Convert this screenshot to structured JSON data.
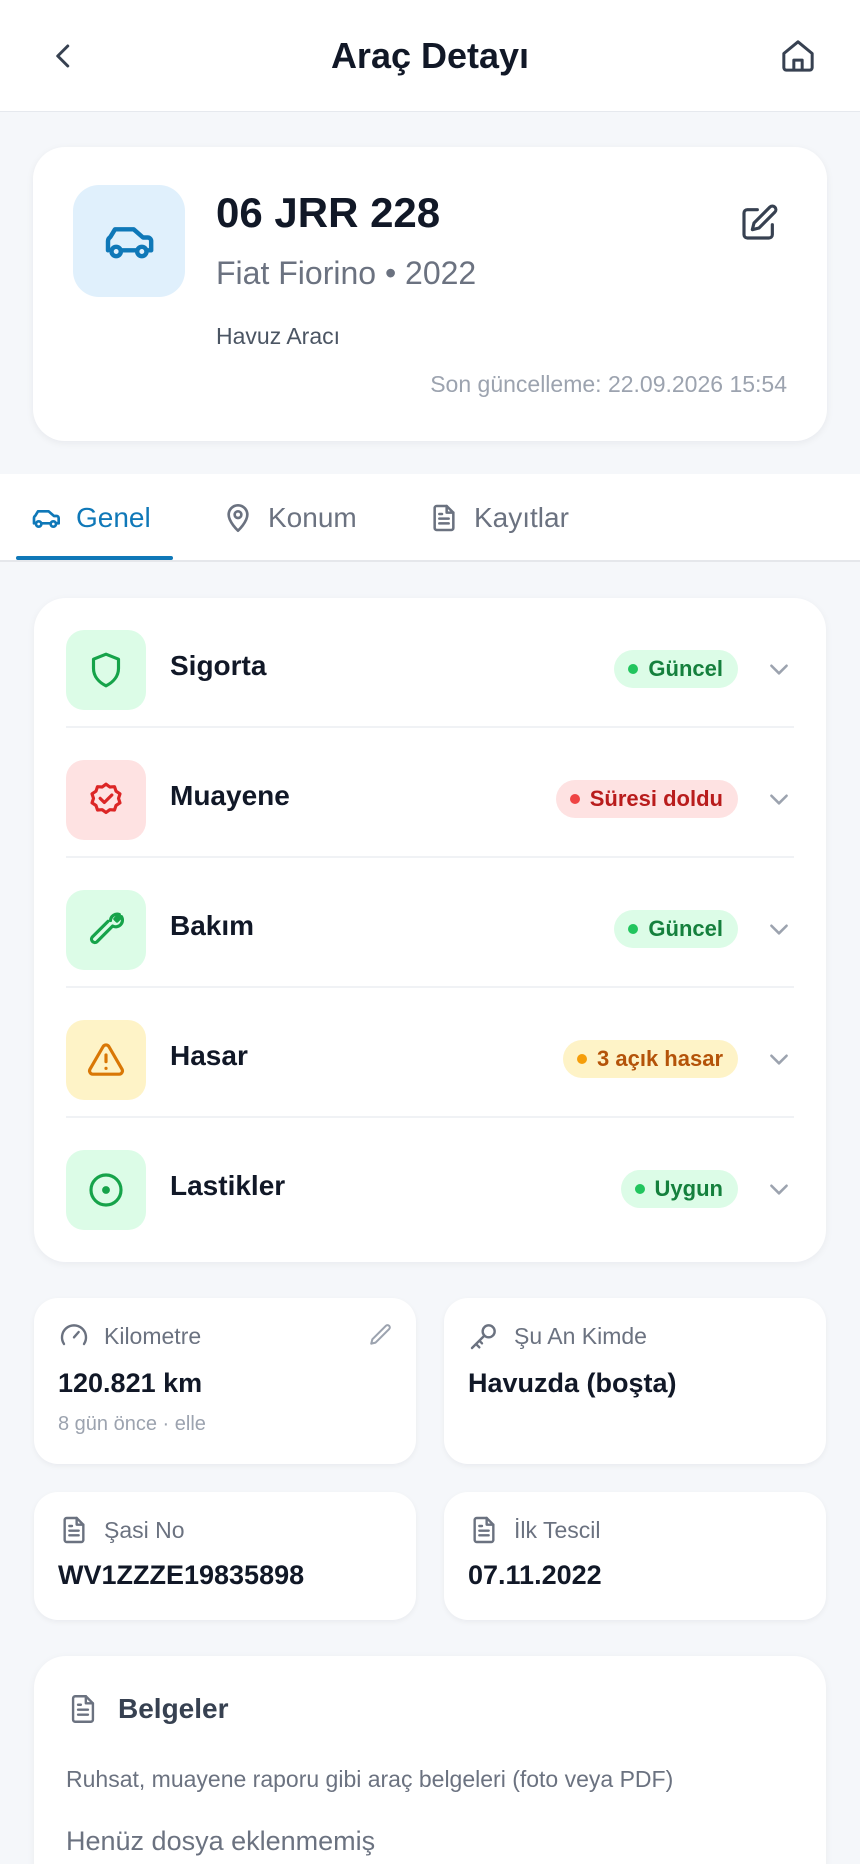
{
  "header": {
    "title": "Araç Detayı",
    "back_icon": "chevron-left-icon",
    "home_icon": "home-icon"
  },
  "vehicle": {
    "plate": "06 JRR 228",
    "model": "Fiat Fiorino • 2022",
    "type": "Havuz Aracı",
    "updated": "Son güncelleme: 22.09.2026 15:54",
    "icon": "car-icon",
    "edit_icon": "edit-icon"
  },
  "tabs": [
    {
      "label": "Genel",
      "icon": "car-icon",
      "active": true
    },
    {
      "label": "Konum",
      "icon": "map-pin-icon",
      "active": false
    },
    {
      "label": "Kayıtlar",
      "icon": "document-icon",
      "active": false
    }
  ],
  "status": [
    {
      "label": "Sigorta",
      "badge": "Güncel",
      "tone": "green",
      "icon": "shield-icon"
    },
    {
      "label": "Muayene",
      "badge": "Süresi doldu",
      "tone": "red",
      "icon": "badge-check-icon"
    },
    {
      "label": "Bakım",
      "badge": "Güncel",
      "tone": "green",
      "icon": "wrench-icon"
    },
    {
      "label": "Hasar",
      "badge": "3 açık hasar",
      "tone": "amber",
      "icon": "warning-icon"
    },
    {
      "label": "Lastikler",
      "badge": "Uygun",
      "tone": "green",
      "icon": "tire-icon"
    }
  ],
  "info": {
    "km": {
      "label": "Kilometre",
      "value": "120.821 km",
      "sub": "8 gün önce · elle"
    },
    "holder": {
      "label": "Şu An Kimde",
      "value": "Havuzda (boşta)"
    },
    "chassis": {
      "label": "Şasi No",
      "value": "WV1ZZZE19835898"
    },
    "registration": {
      "label": "İlk Tescil",
      "value": "07.11.2022"
    }
  },
  "documents": {
    "title": "Belgeler",
    "description": "Ruhsat, muayene raporu gibi araç belgeleri (foto veya PDF)",
    "empty": "Henüz dosya eklenmemiş"
  },
  "colors": {
    "accent": "#0f78b8",
    "green": "#16a34a",
    "red": "#dc2626",
    "amber": "#d97706"
  }
}
